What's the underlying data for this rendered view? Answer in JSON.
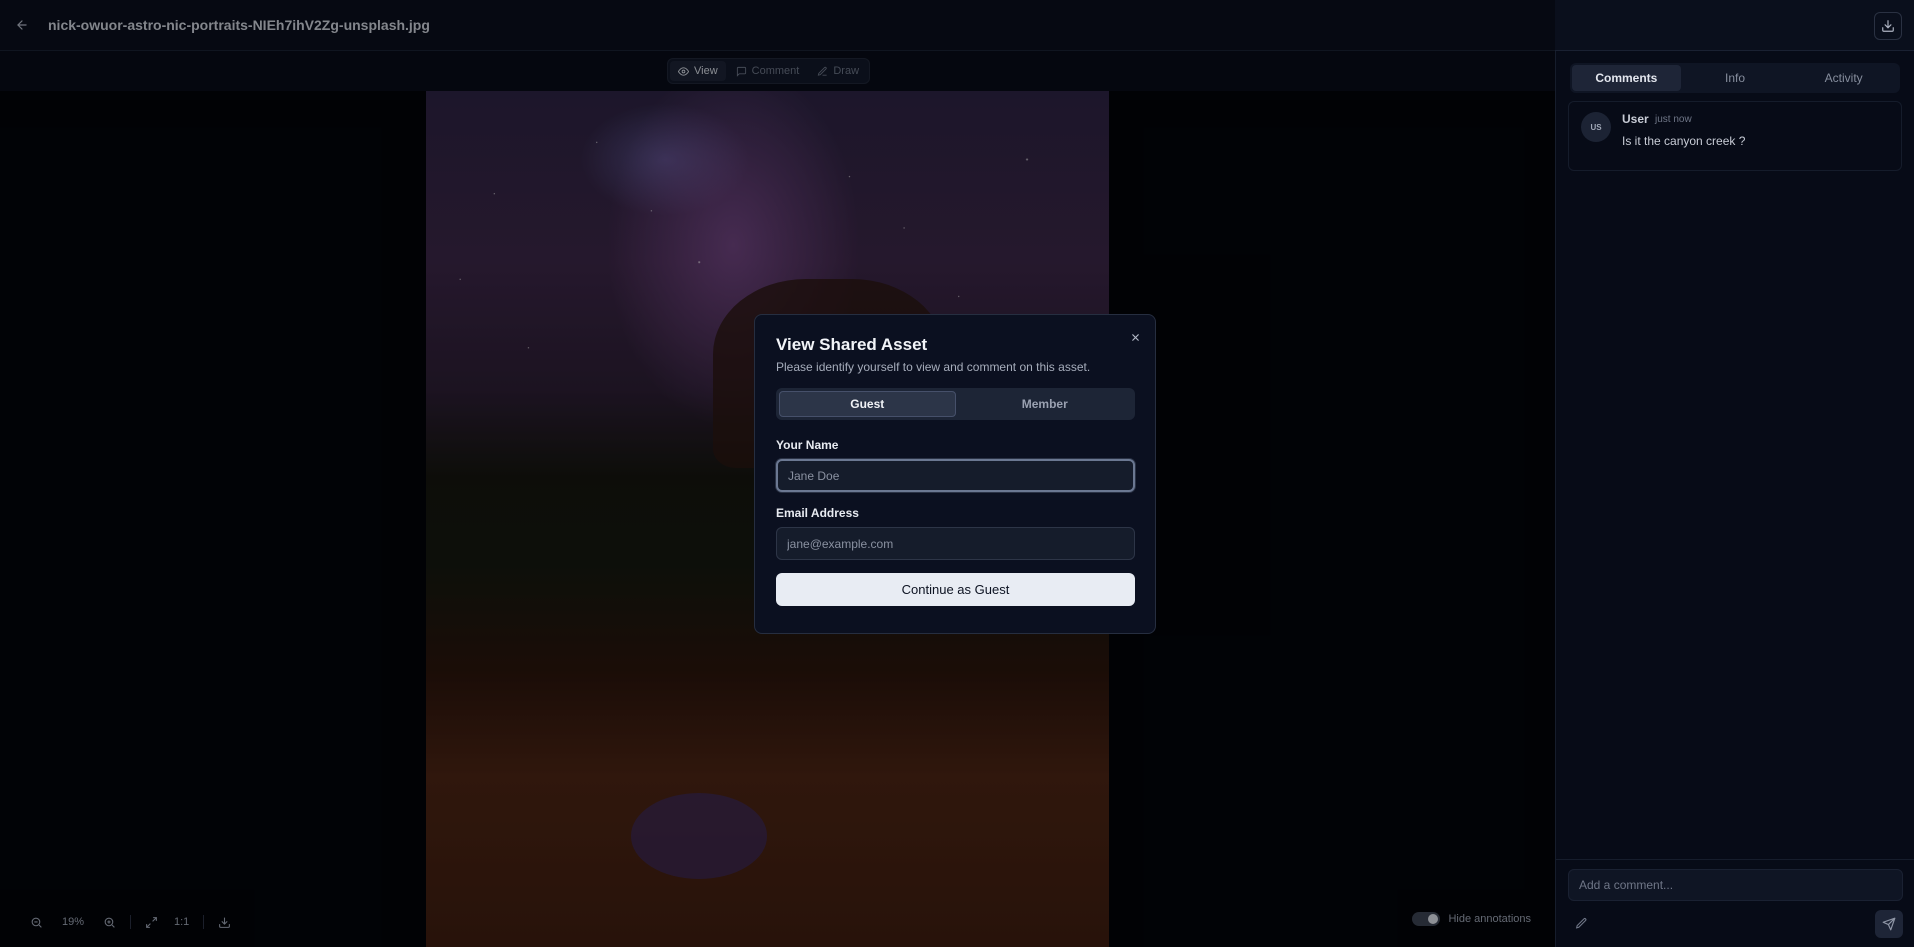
{
  "header": {
    "file_name": "nick-owuor-astro-nic-portraits-NIEh7ihV2Zg-unsplash.jpg",
    "back_icon": "arrow-left-icon",
    "download_icon": "download-icon"
  },
  "viewer": {
    "modes": [
      {
        "label": "View",
        "icon": "eye-icon",
        "active": true
      },
      {
        "label": "Comment",
        "icon": "comment-icon",
        "active": false
      },
      {
        "label": "Draw",
        "icon": "pencil-icon",
        "active": false
      }
    ],
    "zoom_level": "19%",
    "actual_size_label": "1:1",
    "hide_annotations_label": "Hide annotations",
    "hide_annotations_on": true
  },
  "modal": {
    "title": "View Shared Asset",
    "subtitle": "Please identify yourself to view and comment on this asset.",
    "tabs": [
      "Guest",
      "Member"
    ],
    "active_tab": "Guest",
    "name_label": "Your Name",
    "name_placeholder": "Jane Doe",
    "name_value": "",
    "email_label": "Email Address",
    "email_placeholder": "jane@example.com",
    "email_value": "",
    "submit_label": "Continue as Guest"
  },
  "side_panel": {
    "tabs": [
      "Comments",
      "Info",
      "Activity"
    ],
    "active_tab": "Comments",
    "comments": [
      {
        "initials": "US",
        "author": "User",
        "time": "just now",
        "text": "Is it the canyon creek ?"
      }
    ],
    "comment_placeholder": "Add a comment..."
  }
}
